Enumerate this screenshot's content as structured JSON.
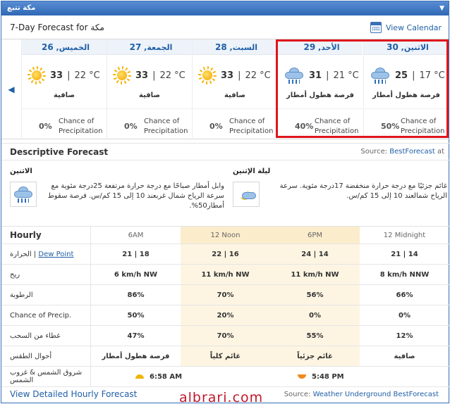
{
  "widget": {
    "title": "مكة تتبع",
    "dropdown_icon": "chevron-down-icon"
  },
  "header": {
    "title_prefix": "7-Day Forecast for",
    "city": "مكة",
    "view_calendar": "View Calendar"
  },
  "days": [
    {
      "name": "الخميس",
      "num": "26",
      "hi": "33",
      "lo": "22 °C",
      "icon": "sun-icon",
      "cond": "صافية",
      "pct": "0%",
      "chance1": "Chance of",
      "chance2": "Precipitation"
    },
    {
      "name": "الجمعة",
      "num": "27",
      "hi": "33",
      "lo": "22 °C",
      "icon": "sun-icon",
      "cond": "صافية",
      "pct": "0%",
      "chance1": "Chance of",
      "chance2": "Precipitation"
    },
    {
      "name": "السبت",
      "num": "28",
      "hi": "33",
      "lo": "22 °C",
      "icon": "sun-icon",
      "cond": "صافية",
      "pct": "0%",
      "chance1": "Chance of",
      "chance2": "Precipitation"
    },
    {
      "name": "الأحد",
      "num": "29",
      "hi": "31",
      "lo": "21 °C",
      "icon": "rain-cloud-icon",
      "cond": "فرصة هطول أمطار",
      "pct": "40%",
      "chance1": "Chance of",
      "chance2": "Precipitation"
    },
    {
      "name": "الاثنين",
      "num": "30",
      "hi": "25",
      "lo": "17 °C",
      "icon": "rain-cloud-icon",
      "cond": "فرصة هطول أمطار",
      "pct": "50%",
      "chance1": "Chance of",
      "chance2": "Precipitation"
    }
  ],
  "descriptive": {
    "title": "Descriptive Forecast",
    "source_label": "Source:",
    "source_link": "BestForecast",
    "source_suffix": "at",
    "blocks": [
      {
        "label": "الاثنين",
        "icon": "rain-cloud-icon",
        "text": "وابل أمطار صباحًا مع درجة حرارة مرتفعة 25درجة مئوية مع سرعة الرياح شمال غربعند 10 إلى 15 كم/س. فرصة سقوط أمطار50%."
      },
      {
        "label": "ليلة الإثنين",
        "icon": "moon-cloud-icon",
        "text": "غائم جزئيًا مع درجة حرارة منخفضة 17درجة مئوية. سرعة الرياح شمالعند 10 إلى 15 كم/س."
      }
    ]
  },
  "hourly": {
    "title": "Hourly",
    "times": [
      "6AM",
      "12 Noon",
      "6PM",
      "12 Midnight"
    ],
    "temp_label_ar": "الحرارة",
    "temp_label_sep": "|",
    "dew_label": "Dew Point",
    "temp": [
      "21 | 18",
      "22 | 16",
      "24 | 14",
      "21 | 14"
    ],
    "wind_label": "ريح",
    "wind": [
      "6 km/h NW",
      "11 km/h NW",
      "11 km/h NW",
      "8 km/h NNW"
    ],
    "humidity_label": "الرطوبة",
    "humidity": [
      "86%",
      "70%",
      "56%",
      "66%"
    ],
    "precip_label": "Chance of Precip.",
    "precip": [
      "50%",
      "20%",
      "0%",
      "0%"
    ],
    "cloud_label": "غطاء من السحب",
    "cloud": [
      "47%",
      "70%",
      "55%",
      "12%"
    ],
    "cond_label": "أحوال الطقس",
    "cond": [
      "فرصة هطول أمطار",
      "غائم كلياً",
      "غائم جزئياً",
      "صافية"
    ],
    "sun_label": "شروق الشمس & غروب الشمس",
    "sunrise": "6:58 AM",
    "sunset": "5:48 PM"
  },
  "footer": {
    "detailed_link": "View Detailed Hourly Forecast",
    "source_label": "Source:",
    "source_link": "Weather Underground BestForecast"
  },
  "watermark": "albrari.com",
  "colors": {
    "accent": "#1f5fa6",
    "highlight_border": "#e0141c",
    "titlebar": "#3b6fb6",
    "column_tint": "#fdf5e2"
  }
}
